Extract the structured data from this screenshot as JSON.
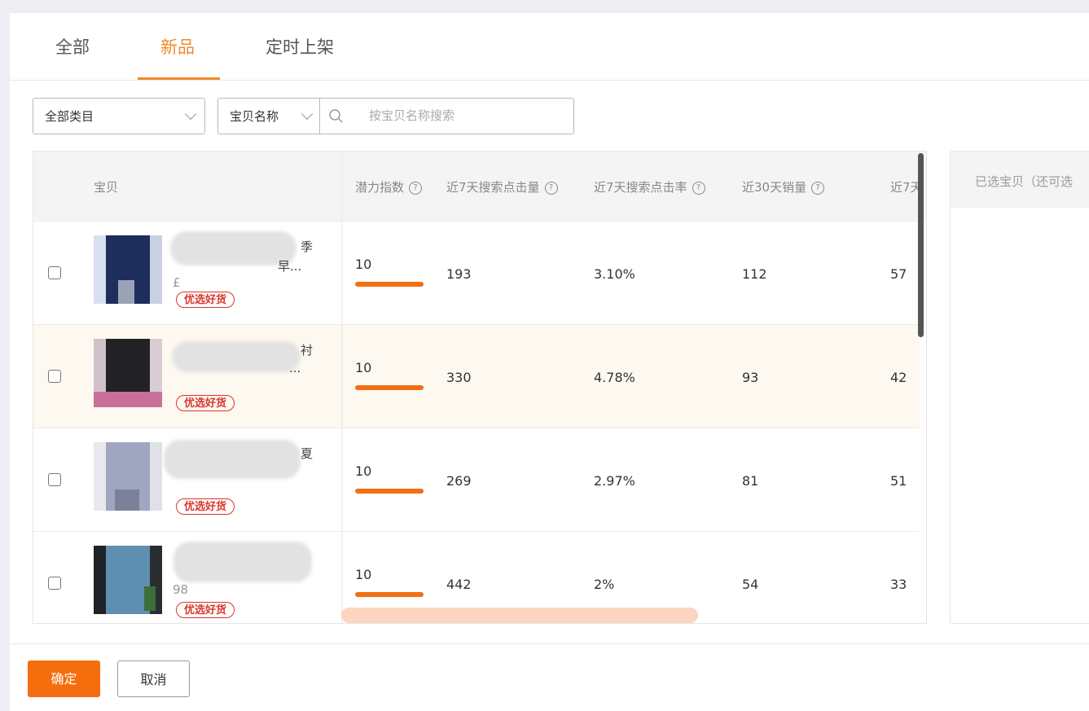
{
  "tabs": [
    "全部",
    "新品",
    "定时上架"
  ],
  "filters": {
    "category": "全部类目",
    "search_field": "宝贝名称",
    "search_placeholder": "按宝贝名称搜索"
  },
  "table": {
    "columns": [
      "宝贝",
      "潜力指数",
      "近7天搜索点击量",
      "近7天搜索点击率",
      "近30天销量",
      "近7天"
    ],
    "rows": [
      {
        "title_end_1": "季",
        "title_end_2": "早...",
        "price_frag": "£",
        "badge": "优选好货",
        "potential": "10",
        "potential_level": 1.0,
        "clicks": "193",
        "ctr": "3.10%",
        "sales30": "112",
        "last": "57"
      },
      {
        "title_end_1": "衬",
        "title_end_2": "...",
        "price_frag": "",
        "badge": "优选好货",
        "potential": "10",
        "potential_level": 1.0,
        "clicks": "330",
        "ctr": "4.78%",
        "sales30": "93",
        "last": "42"
      },
      {
        "title_end_1": "夏",
        "title_end_2": "",
        "price_frag": "",
        "badge": "优选好货",
        "potential": "10",
        "potential_level": 1.0,
        "clicks": "269",
        "ctr": "2.97%",
        "sales30": "81",
        "last": "51"
      },
      {
        "title_end_1": "",
        "title_end_2": "",
        "price_frag": "98",
        "badge": "优选好货",
        "potential": "10",
        "potential_level": 1.0,
        "clicks": "442",
        "ctr": "2%",
        "sales30": "54",
        "last": "33"
      }
    ]
  },
  "selected_panel": {
    "header": "已选宝贝（还可选"
  },
  "footer": {
    "confirm": "确定",
    "cancel": "取消"
  },
  "colors": {
    "accent": "#f08a2b",
    "bar": "#f07013",
    "badge": "#d9362b",
    "primary_button": "#f66d0d"
  }
}
